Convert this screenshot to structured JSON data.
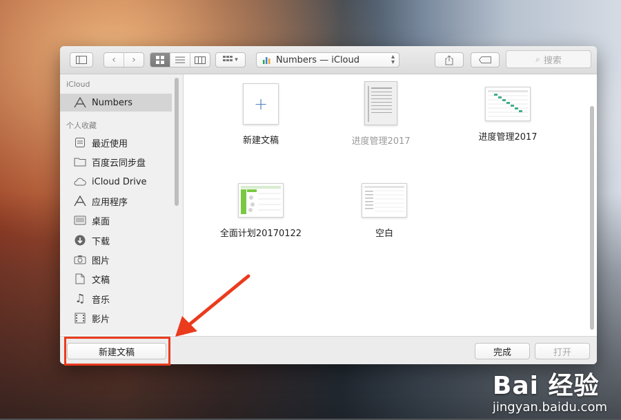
{
  "window": {
    "location": {
      "app": "Numbers",
      "path": "Numbers — iCloud"
    },
    "search": {
      "placeholder": "搜索"
    }
  },
  "sidebar": {
    "groups": [
      {
        "title": "iCloud",
        "items": [
          {
            "label": "Numbers",
            "icon": "numbers-app-icon",
            "selected": true
          }
        ]
      },
      {
        "title": "个人收藏",
        "items": [
          {
            "label": "最近使用",
            "icon": "recent-icon"
          },
          {
            "label": "百度云同步盘",
            "icon": "folder-icon"
          },
          {
            "label": "iCloud Drive",
            "icon": "cloud-icon"
          },
          {
            "label": "应用程序",
            "icon": "applications-icon"
          },
          {
            "label": "桌面",
            "icon": "desktop-icon"
          },
          {
            "label": "下载",
            "icon": "download-icon"
          },
          {
            "label": "图片",
            "icon": "camera-icon"
          },
          {
            "label": "文稿",
            "icon": "document-icon"
          },
          {
            "label": "音乐",
            "icon": "music-note-icon"
          },
          {
            "label": "影片",
            "icon": "film-icon"
          }
        ]
      }
    ]
  },
  "files": [
    {
      "label": "新建文稿",
      "kind": "new",
      "dim": false
    },
    {
      "label": "进度管理2017",
      "kind": "doc",
      "dim": true
    },
    {
      "label": "进度管理2017",
      "kind": "sheet",
      "dim": false
    },
    {
      "label": "全面计划20170122",
      "kind": "sheet-green",
      "dim": false
    },
    {
      "label": "空白",
      "kind": "blank",
      "dim": false
    }
  ],
  "buttons": {
    "new_document": "新建文稿",
    "done": "完成",
    "open": "打开"
  },
  "watermark": {
    "brand": "Bai 经验",
    "url": "jingyan.baidu.com"
  },
  "colors": {
    "annotation": "#ea3b1d",
    "selected": "#d4d4d4",
    "numbers_green": "#2aa84a"
  }
}
